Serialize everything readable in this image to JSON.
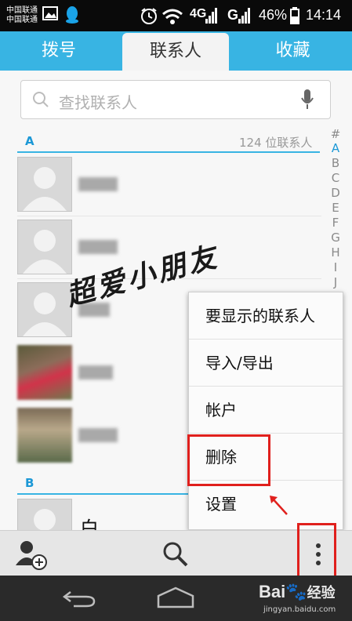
{
  "status_bar": {
    "carrier_1": "中国联通",
    "carrier_2": "中国联通",
    "network": "4G",
    "network2": "G",
    "battery": "46%",
    "time": "14:14"
  },
  "tabs": [
    {
      "label": "拨号"
    },
    {
      "label": "联系人"
    },
    {
      "label": "收藏"
    }
  ],
  "search": {
    "placeholder": "查找联系人"
  },
  "contacts": {
    "section_a": "A",
    "count_text": "124 位联系人",
    "section_b": "B",
    "b_first_name": "白"
  },
  "alphabet": [
    "#",
    "A",
    "B",
    "C",
    "D",
    "E",
    "F",
    "G",
    "H",
    "I",
    "J"
  ],
  "menu": {
    "items": [
      "要显示的联系人",
      "导入/导出",
      "帐户",
      "删除",
      "设置"
    ]
  },
  "watermark": "超爱小朋友",
  "footer": {
    "baidu": "Bai",
    "baidu2": "经验",
    "site": "jingyan.baidu.com"
  },
  "colors": {
    "accent": "#38b4e3",
    "highlight": "#e0201d"
  }
}
